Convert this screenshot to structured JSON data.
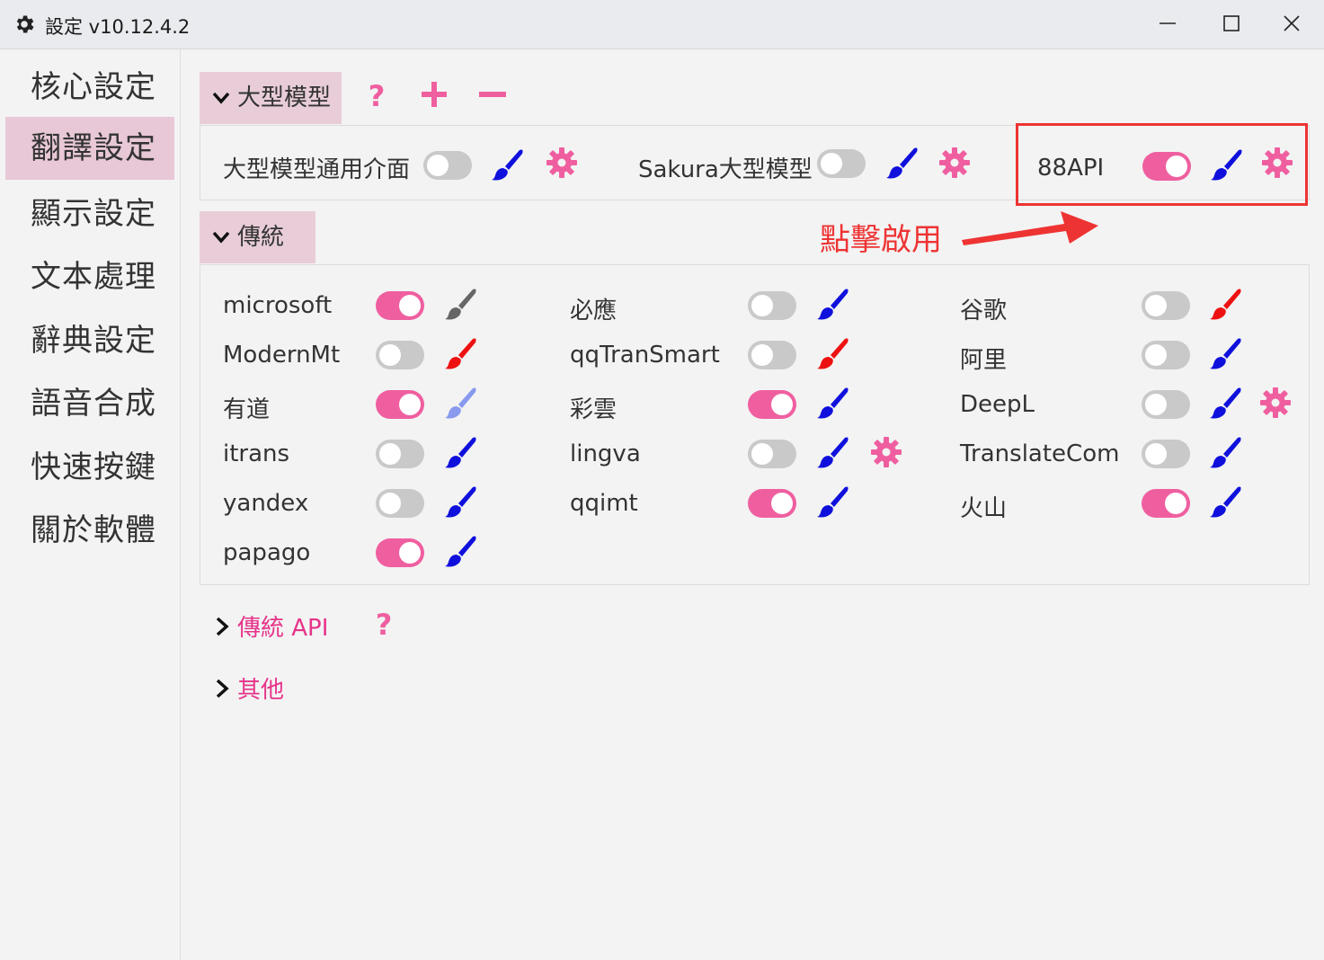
{
  "window": {
    "title": "設定 v10.12.4.2"
  },
  "sidebar": {
    "items": [
      {
        "label": "核心設定"
      },
      {
        "label": "翻譯設定"
      },
      {
        "label": "顯示設定"
      },
      {
        "label": "文本處理"
      },
      {
        "label": "辭典設定"
      },
      {
        "label": "語音合成"
      },
      {
        "label": "快速按鍵"
      },
      {
        "label": "關於軟體"
      }
    ],
    "active_index": 1
  },
  "llm_section": {
    "title": "大型模型",
    "items": [
      {
        "label": "大型模型通用介面",
        "enabled": false,
        "brush_color": "#1010dd",
        "has_settings": true
      },
      {
        "label": "Sakura大型模型",
        "enabled": false,
        "brush_color": "#1010dd",
        "has_settings": true
      },
      {
        "label": "88API",
        "enabled": true,
        "brush_color": "#1010dd",
        "has_settings": true
      }
    ]
  },
  "annotation": {
    "text": "點擊啟用",
    "color": "#ee3333"
  },
  "traditional_section": {
    "title": "傳統",
    "columns": [
      [
        {
          "label": "microsoft",
          "enabled": true,
          "brush_color": "#666666"
        },
        {
          "label": "ModernMt",
          "enabled": false,
          "brush_color": "#ee1111"
        },
        {
          "label": "有道",
          "enabled": true,
          "brush_color": "#8899ee"
        },
        {
          "label": "itrans",
          "enabled": false,
          "brush_color": "#1010dd"
        },
        {
          "label": "yandex",
          "enabled": false,
          "brush_color": "#1010dd"
        },
        {
          "label": "papago",
          "enabled": true,
          "brush_color": "#1010dd"
        }
      ],
      [
        {
          "label": "必應",
          "enabled": false,
          "brush_color": "#1010dd"
        },
        {
          "label": "qqTranSmart",
          "enabled": false,
          "brush_color": "#ee1111"
        },
        {
          "label": "彩雲",
          "enabled": true,
          "brush_color": "#1010dd"
        },
        {
          "label": "lingva",
          "enabled": false,
          "brush_color": "#1010dd",
          "has_settings": true
        },
        {
          "label": "qqimt",
          "enabled": true,
          "brush_color": "#1010dd"
        }
      ],
      [
        {
          "label": "谷歌",
          "enabled": false,
          "brush_color": "#ee1111"
        },
        {
          "label": "阿里",
          "enabled": false,
          "brush_color": "#1010dd"
        },
        {
          "label": "DeepL",
          "enabled": false,
          "brush_color": "#1010dd",
          "has_settings": true
        },
        {
          "label": "TranslateCom",
          "enabled": false,
          "brush_color": "#1010dd"
        },
        {
          "label": "火山",
          "enabled": true,
          "brush_color": "#1010dd"
        }
      ]
    ]
  },
  "collapsed_sections": [
    {
      "label": "傳統 API",
      "has_help": true
    },
    {
      "label": "其他",
      "has_help": false
    }
  ],
  "colors": {
    "accent": "#ef5fa0",
    "pink_text": "#e6338a",
    "header_bg": "#e8cdd8"
  }
}
